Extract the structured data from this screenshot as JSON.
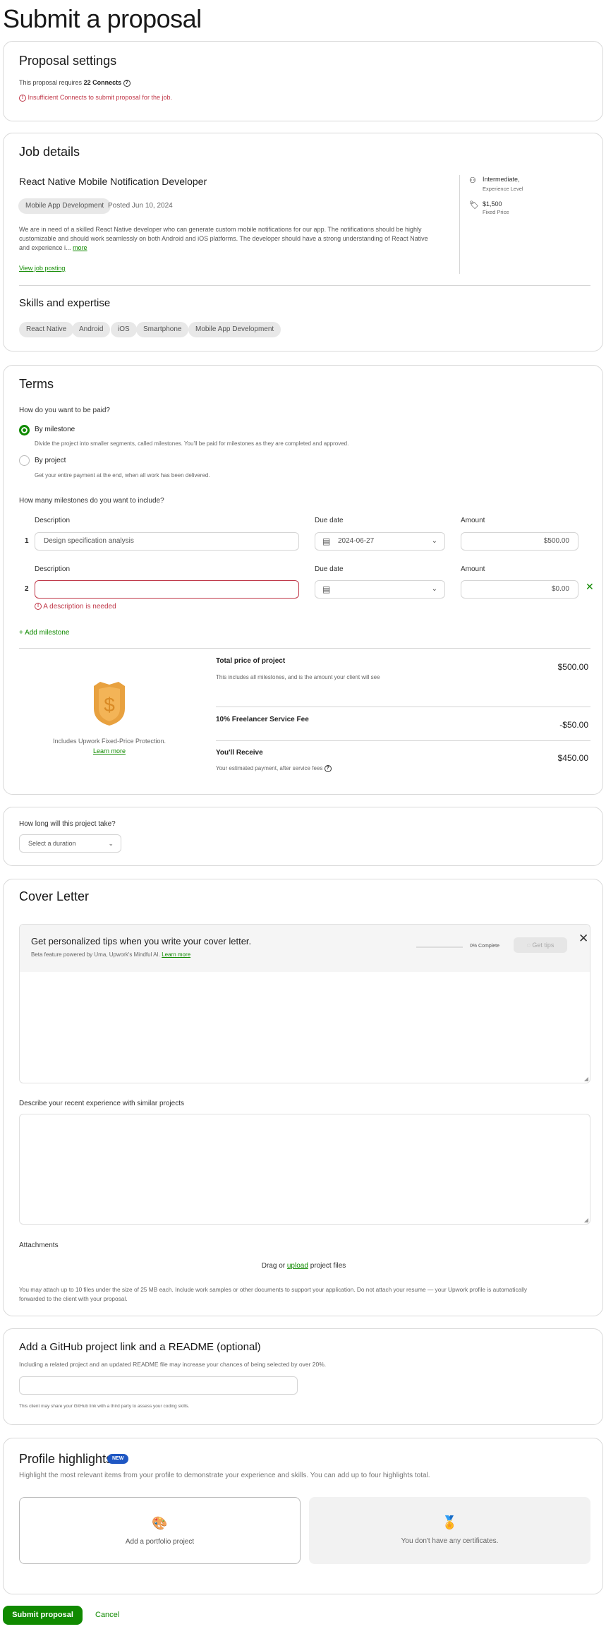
{
  "page_title": "Submit a proposal",
  "proposal_settings": {
    "title": "Proposal settings",
    "requires_prefix": "This proposal requires",
    "connects": "22 Connects",
    "error": "Insufficient Connects to submit proposal for the job."
  },
  "job": {
    "section_title": "Job details",
    "title": "React Native Mobile Notification Developer",
    "category": "Mobile App Development",
    "posted": "Posted Jun 10, 2024",
    "description_lines": [
      "We are in need of a skilled React Native developer who can generate custom mobile notifications for our app. The notifications should be highly",
      "customizable and should work seamlessly on both Android and iOS platforms. The developer should have a strong understanding of React Native",
      "and experience i..."
    ],
    "more": "more",
    "view_posting": "View job posting",
    "level": "Intermediate,",
    "level_label": "Experience Level",
    "price": "$1,500",
    "price_label": "Fixed Price",
    "skills_title": "Skills and expertise",
    "skills": [
      "React Native",
      "Android",
      "iOS",
      "Smartphone",
      "Mobile App Development"
    ]
  },
  "terms": {
    "title": "Terms",
    "pay_question": "How do you want to be paid?",
    "options": [
      {
        "label": "By milestone",
        "desc": "Divide the project into smaller segments, called milestones. You'll be paid for milestones as they are completed and approved.",
        "selected": true
      },
      {
        "label": "By project",
        "desc": "Get your entire payment at the end, when all work has been delivered.",
        "selected": false
      }
    ],
    "milestones_question": "How many milestones do you want to include?",
    "col_description": "Description",
    "col_due": "Due date",
    "col_amount": "Amount",
    "milestones": [
      {
        "num": "1",
        "description": "Design specification analysis",
        "due": "2024-06-27",
        "amount": "$500.00"
      },
      {
        "num": "2",
        "description": "",
        "due": "",
        "amount": "$0.00",
        "error": "A description is needed"
      }
    ],
    "add_milestone": "+ Add milestone",
    "protection": "Includes Upwork Fixed-Price Protection.",
    "learn_more": "Learn more",
    "total_label": "Total price of project",
    "total_desc": "This includes all milestones, and is the amount your client will see",
    "total": "$500.00",
    "fee_label": "10% Freelancer Service Fee",
    "fee": "-$50.00",
    "receive_label": "You'll Receive",
    "receive_desc": "Your estimated payment, after service fees",
    "receive": "$450.00"
  },
  "duration": {
    "question": "How long will this project take?",
    "placeholder": "Select a duration"
  },
  "cover": {
    "title": "Cover Letter",
    "tips_title": "Get personalized tips when you write your cover letter.",
    "tips_sub": "Beta feature powered by Uma, Upwork's Mindful AI.",
    "learn_more": "Learn more",
    "progress_label": "0% Complete",
    "progress": 0,
    "get_tips": "Get tips",
    "experience_label": "Describe your recent experience with similar projects",
    "attachments": "Attachments",
    "drag": "Drag or",
    "upload": "upload",
    "files": "project files",
    "note_lines": [
      "You may attach up to 10 files under the size of 25 MB each. Include work samples or other documents to support your application. Do not attach your resume — your Upwork profile is automatically",
      "forwarded to the client with your proposal."
    ]
  },
  "github": {
    "title": "Add a GitHub project link and a README (optional)",
    "desc": "Including a related project and an updated README file may increase your chances of being selected by over 20%.",
    "note": "This client may share your GitHub link with a third party to assess your coding skills."
  },
  "highlights": {
    "title": "Profile highlights",
    "badge": "NEW",
    "desc": "Highlight the most relevant items from your profile to demonstrate your experience and skills. You can add up to four highlights total.",
    "portfolio": "Add a portfolio project",
    "certificates": "You don't have any certificates."
  },
  "actions": {
    "submit": "Submit proposal",
    "cancel": "Cancel"
  },
  "colors": {
    "accent": "#108a00",
    "error": "#c0394a",
    "badge": "#1f57c3"
  }
}
